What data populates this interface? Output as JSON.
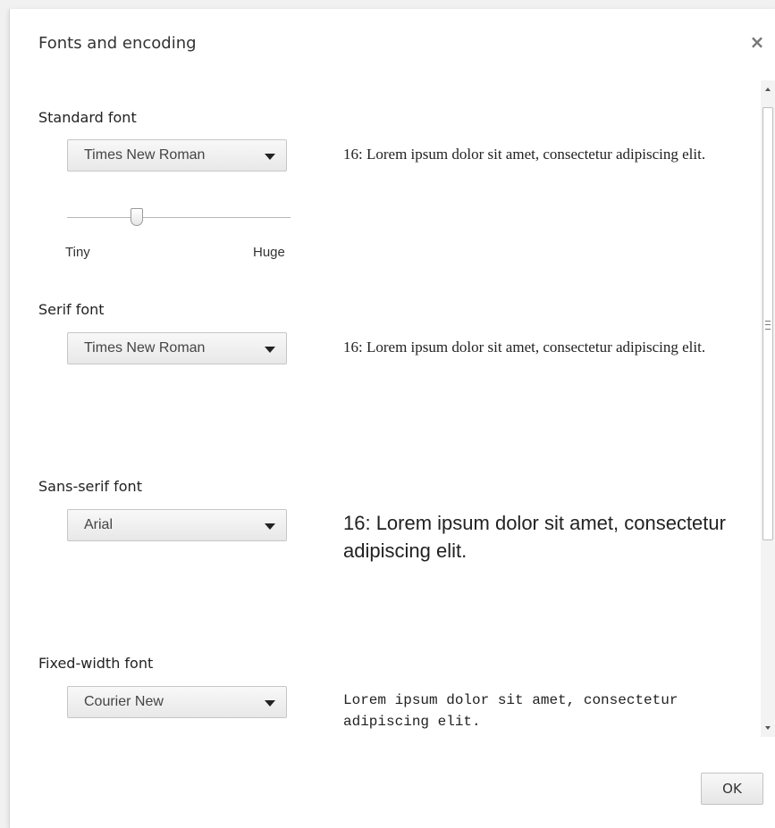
{
  "dialog": {
    "title": "Fonts and encoding",
    "close_glyph": "×",
    "ok_label": "OK"
  },
  "standard": {
    "label": "Standard font",
    "selected": "Times New Roman",
    "preview": "16: Lorem ipsum dolor sit amet, consectetur adipiscing elit.",
    "slider": {
      "min_label": "Tiny",
      "max_label": "Huge",
      "value_fraction": 0.31
    }
  },
  "serif": {
    "label": "Serif font",
    "selected": "Times New Roman",
    "preview": "16: Lorem ipsum dolor sit amet, consectetur adipiscing elit."
  },
  "sans": {
    "label": "Sans-serif font",
    "selected": "Arial",
    "preview": "16: Lorem ipsum dolor sit amet, consectetur adipiscing elit."
  },
  "fixed": {
    "label": "Fixed-width font",
    "selected": "Courier New",
    "preview": "Lorem ipsum dolor sit amet, consectetur adipiscing elit."
  },
  "icons": {
    "close": "close-icon",
    "dropdown": "chevron-down-icon",
    "scroll_up": "arrow-up-icon",
    "scroll_down": "arrow-down-icon"
  }
}
